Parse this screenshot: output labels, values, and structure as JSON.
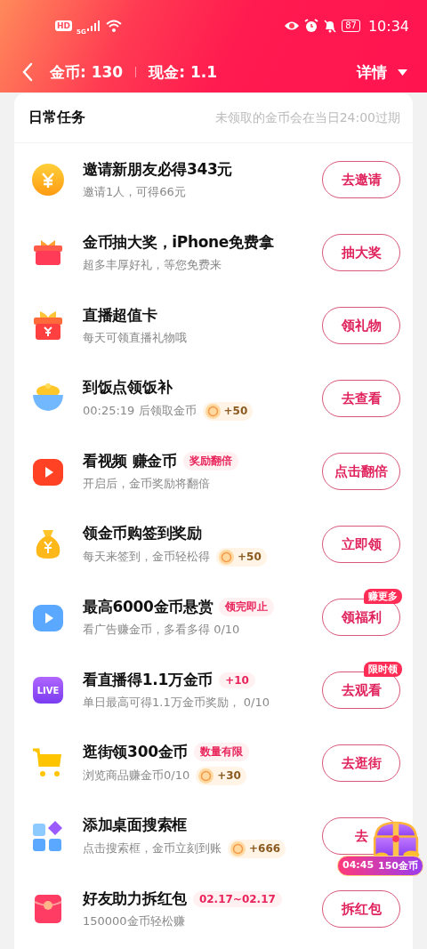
{
  "status_bar": {
    "network_badge": "HD",
    "network_type": "5G",
    "battery": "87",
    "time": "10:34"
  },
  "header": {
    "coins": "金币: 130",
    "cash": "现金: 1.1",
    "details": "详情"
  },
  "section": {
    "title": "日常任务",
    "note": "未领取的金币会在当日24:00过期"
  },
  "tasks": [
    {
      "title": "邀请新朋友必得343元",
      "subtitle": "邀请1人，可得66元",
      "button": "去邀请"
    },
    {
      "title": "金币抽大奖，iPhone免费拿",
      "subtitle": "超多丰厚好礼，等您免费来",
      "button": "抽大奖"
    },
    {
      "title": "直播超值卡",
      "subtitle": "每天可领直播礼物哦",
      "button": "领礼物"
    },
    {
      "title": "到饭点领饭补",
      "subtitle": "00:25:19 后领取金币",
      "reward": "+50",
      "button": "去查看"
    },
    {
      "title": "看视频 赚金币",
      "tag": "奖励翻倍",
      "subtitle": "开启后，金币奖励将翻倍",
      "button": "点击翻倍"
    },
    {
      "title": "领金币购签到奖励",
      "subtitle": "每天来签到，金币轻松得",
      "reward": "+50",
      "button": "立即领"
    },
    {
      "title": "最高6000金币悬赏",
      "tag": "领完即止",
      "subtitle": "看广告赚金币，多看多得 0/10",
      "button": "领福利",
      "badge": "赚更多"
    },
    {
      "title": "看直播得1.1万金币",
      "tag": "+10",
      "icon_text": "LIVE",
      "subtitle": "单日最高可得1.1万金币奖励， 0/10",
      "button": "去观看",
      "badge": "限时领"
    },
    {
      "title": "逛街领300金币",
      "tag": "数量有限",
      "subtitle": "浏览商品赚金币0/10",
      "reward": "+30",
      "button": "去逛街"
    },
    {
      "title": "添加桌面搜索框",
      "subtitle": "点击搜索框，金币立刻到账",
      "reward": "+666",
      "button": "去"
    },
    {
      "title": "好友助力拆红包",
      "tag": "02.17~02.17",
      "subtitle": "150000金币轻松赚",
      "button": "拆红包"
    }
  ],
  "floating_reward": {
    "timer": "04:45",
    "amount": "150金币"
  }
}
